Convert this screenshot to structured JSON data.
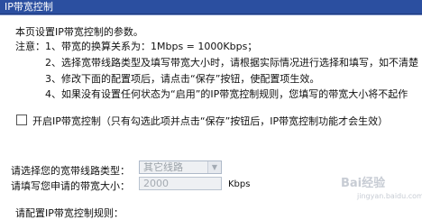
{
  "header": {
    "title": "IP带宽控制"
  },
  "intro": "本页设置IP带宽控制的参数。",
  "notes": {
    "label": "注意：",
    "items": [
      "1、带宽的换算关系为：1Mbps = 1000Kbps；",
      "2、选择宽带线路类型及填写带宽大小时，请根据实际情况进行选择和填写，如不清楚",
      "3、修改下面的配置项后，请点击“保存”按钮，使配置项生效。",
      "4、如果没有设置任何状态为“启用”的IP带宽控制规则，您填写的带宽大小将不起作"
    ]
  },
  "enable": {
    "label": "开启IP带宽控制（只有勾选此项并点击“保存”按钮后，IP带宽控制功能才会生效）",
    "checked": false
  },
  "line_type": {
    "label": "请选择您的宽带线路类型：",
    "value": "其它线路"
  },
  "bandwidth": {
    "label": "请填写您申请的带宽大小：",
    "value": "2000",
    "unit": "Kbps"
  },
  "rules": {
    "label": "请配置IP带宽控制规则："
  },
  "watermark": {
    "text": "Bai经验",
    "sub": "jingyan.baidu.com"
  }
}
